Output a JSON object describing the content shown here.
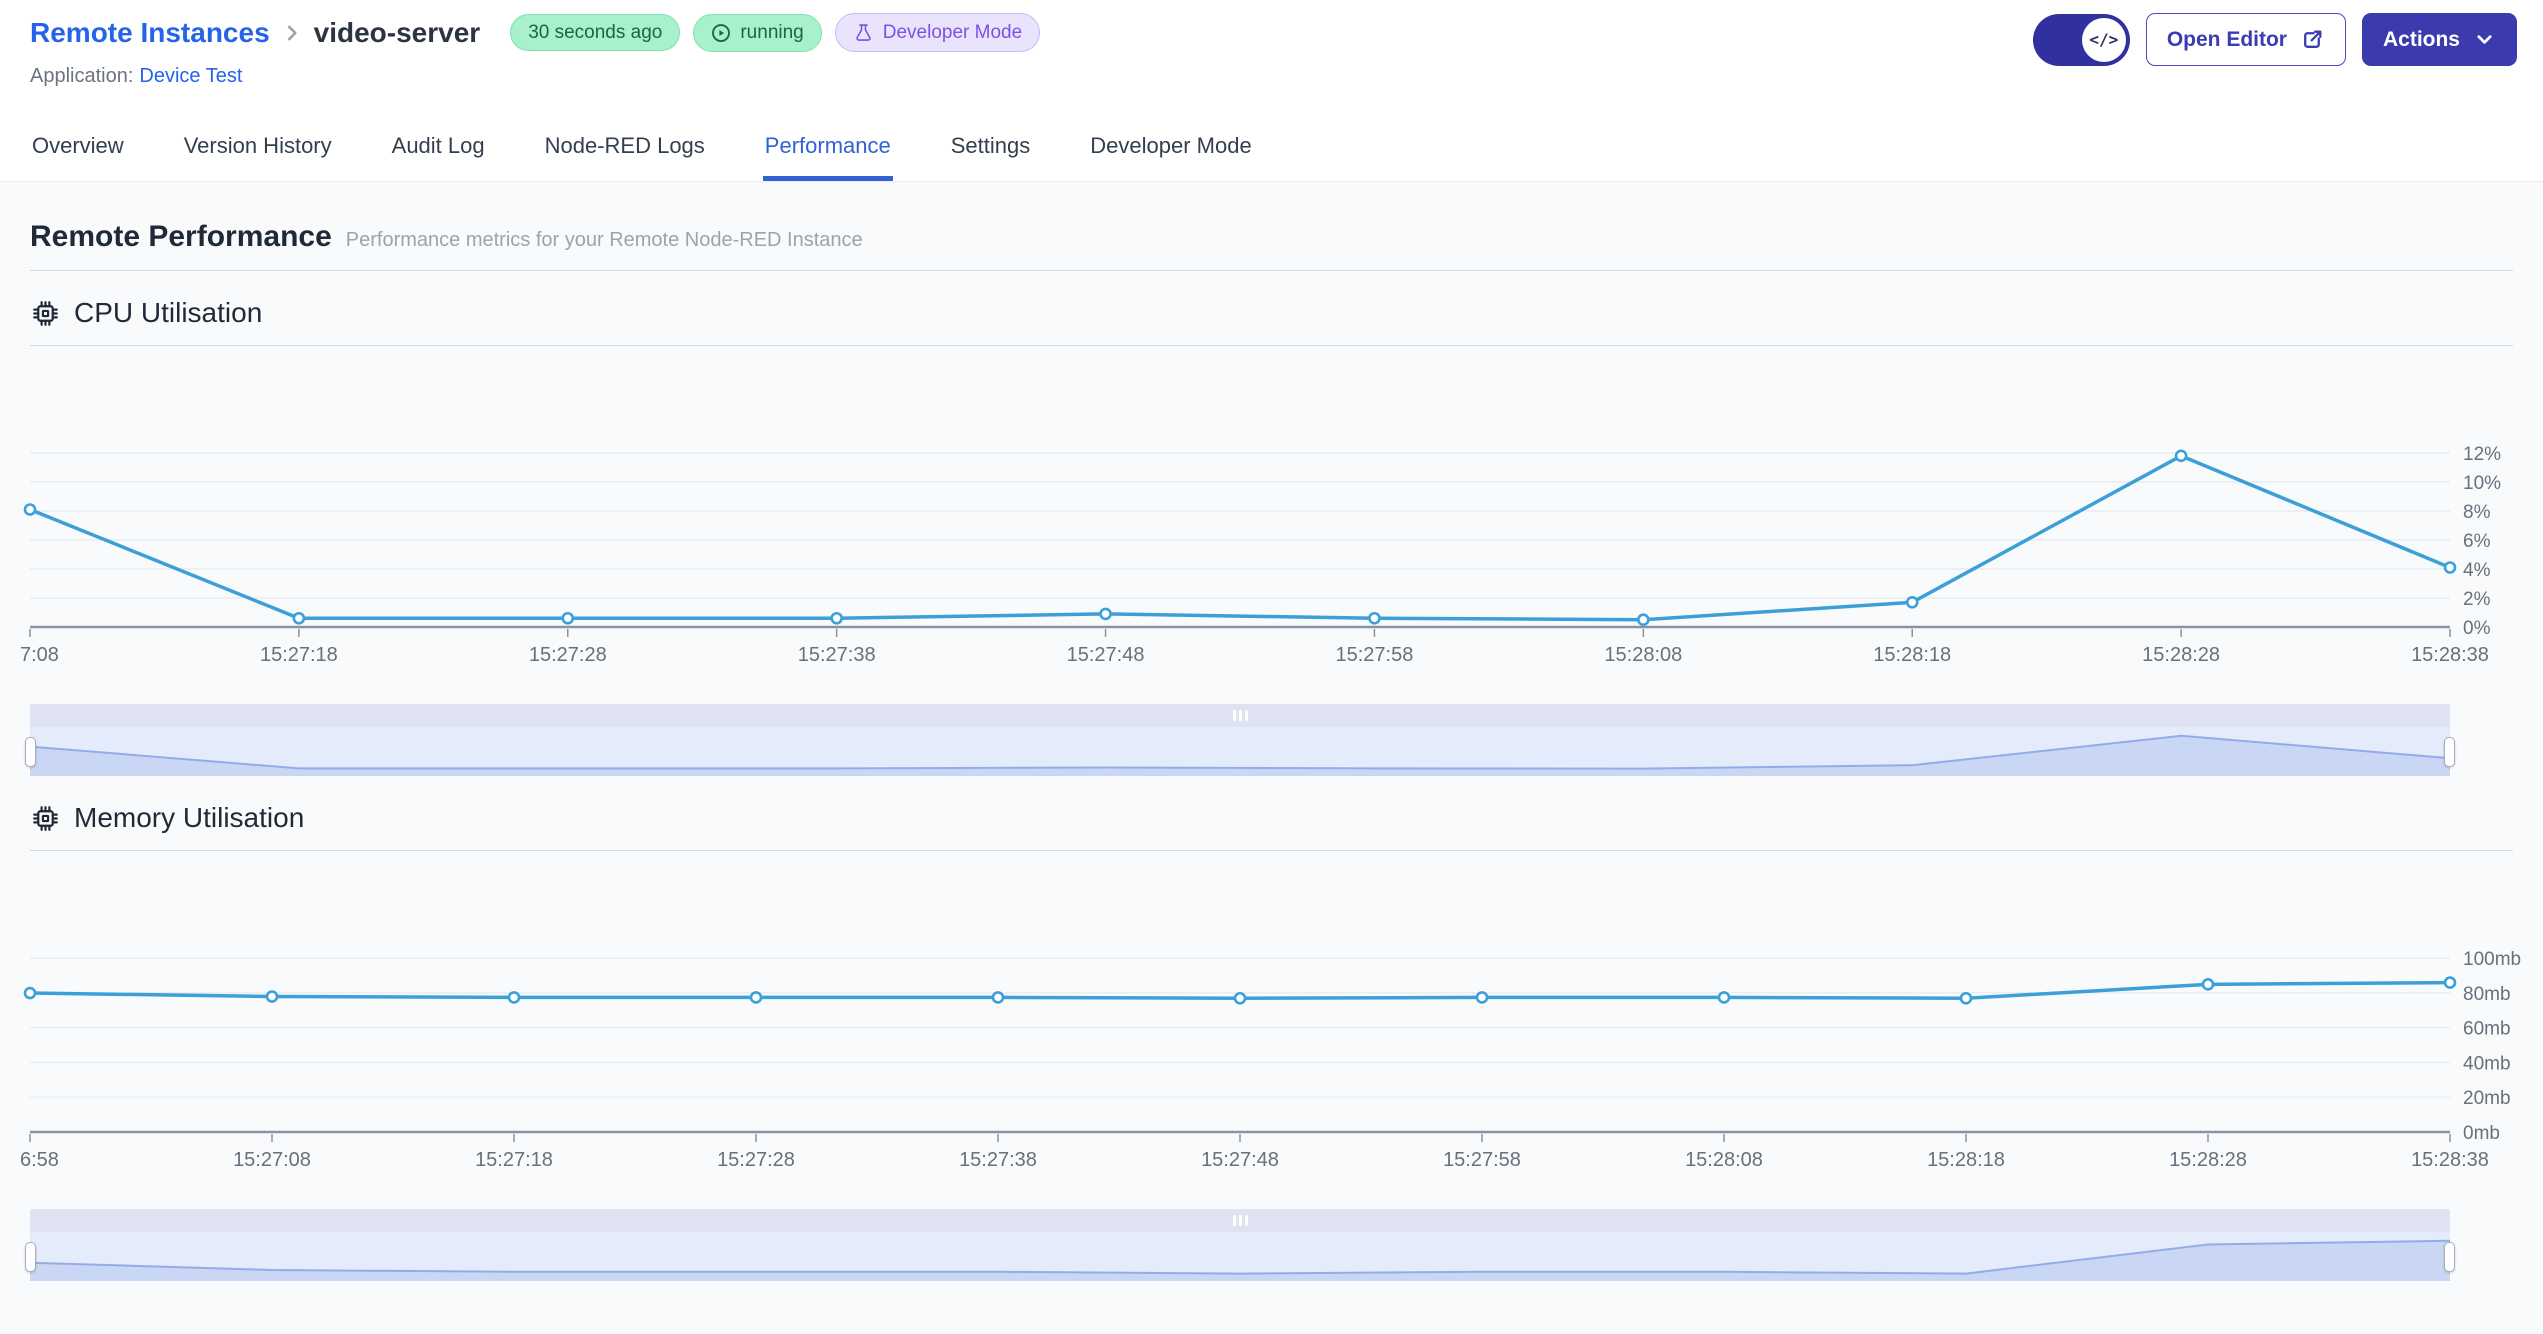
{
  "header": {
    "breadcrumb_root": "Remote Instances",
    "instance_name": "video-server",
    "badges": {
      "last_seen": "30 seconds ago",
      "status": "running",
      "mode": "Developer Mode"
    },
    "application_label": "Application:",
    "application_name": "Device Test",
    "open_editor_label": "Open Editor",
    "actions_label": "Actions"
  },
  "tabs": [
    {
      "label": "Overview",
      "active": false
    },
    {
      "label": "Version History",
      "active": false
    },
    {
      "label": "Audit Log",
      "active": false
    },
    {
      "label": "Node-RED Logs",
      "active": false
    },
    {
      "label": "Performance",
      "active": true
    },
    {
      "label": "Settings",
      "active": false
    },
    {
      "label": "Developer Mode",
      "active": false
    }
  ],
  "page": {
    "title": "Remote Performance",
    "subtitle": "Performance metrics for your Remote Node-RED Instance"
  },
  "colors": {
    "accent_blue": "#3061D5",
    "link_blue": "#2563EB",
    "chart_line": "#3BA0D8",
    "badge_green_text": "#156A43",
    "badge_purple_text": "#7C52E5",
    "button_indigo": "#3B3AAE"
  },
  "chart_data": [
    {
      "type": "line",
      "title": "CPU Utilisation",
      "xlabel": "",
      "ylabel": "",
      "unit": "%",
      "ylim": [
        0,
        12
      ],
      "ytick_step": 2,
      "grid": true,
      "legend": "none",
      "line_color": "#3BA0D8",
      "x": [
        "7:08",
        "15:27:18",
        "15:27:28",
        "15:27:38",
        "15:27:48",
        "15:27:58",
        "15:28:08",
        "15:28:18",
        "15:28:28",
        "15:28:38"
      ],
      "values": [
        8,
        0.5,
        0.5,
        0.5,
        0.8,
        0.5,
        0.4,
        1.6,
        11.7,
        4
      ]
    },
    {
      "type": "line",
      "title": "Memory Utilisation",
      "xlabel": "",
      "ylabel": "",
      "unit": "mb",
      "ylim": [
        0,
        100
      ],
      "ytick_step": 20,
      "grid": true,
      "legend": "none",
      "line_color": "#3BA0D8",
      "x": [
        "6:58",
        "15:27:08",
        "15:27:18",
        "15:27:28",
        "15:27:38",
        "15:27:48",
        "15:27:58",
        "15:28:08",
        "15:28:18",
        "15:28:28",
        "15:28:38"
      ],
      "values": [
        79,
        77,
        76.5,
        76.5,
        76.5,
        76,
        76.5,
        76.5,
        76,
        84,
        85
      ]
    }
  ]
}
